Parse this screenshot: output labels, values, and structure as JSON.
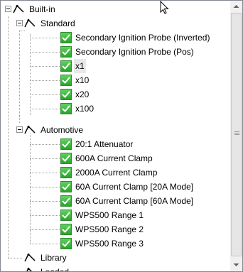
{
  "tree": {
    "builtin": {
      "label": "Built-in"
    },
    "standard": {
      "label": "Standard",
      "items": [
        {
          "label": "Secondary Ignition Probe (Inverted)",
          "checked": true
        },
        {
          "label": "Secondary Ignition Probe (Pos)",
          "checked": true
        },
        {
          "label": "x1",
          "checked": true,
          "selected": true
        },
        {
          "label": "x10",
          "checked": true
        },
        {
          "label": "x20",
          "checked": true
        },
        {
          "label": "x100",
          "checked": true
        }
      ]
    },
    "automotive": {
      "label": "Automotive",
      "items": [
        {
          "label": "20:1 Attenuator",
          "checked": true
        },
        {
          "label": "600A Current Clamp",
          "checked": true
        },
        {
          "label": "2000A Current Clamp",
          "checked": true
        },
        {
          "label": "60A Current Clamp [20A Mode]",
          "checked": true
        },
        {
          "label": "60A Current Clamp [60A Mode]",
          "checked": true
        },
        {
          "label": "WPS500 Range 1",
          "checked": true
        },
        {
          "label": "WPS500 Range 2",
          "checked": true
        },
        {
          "label": "WPS500 Range 3",
          "checked": true
        }
      ]
    },
    "library": {
      "label": "Library"
    },
    "loaded": {
      "label": "Loaded"
    }
  },
  "icons": {
    "probe": "probe-icon",
    "checkbox": "checkbox-checked-icon",
    "expander": "collapse-minus-icon"
  },
  "colors": {
    "check_green": "#28a428",
    "selection": "#e8e8e8"
  }
}
